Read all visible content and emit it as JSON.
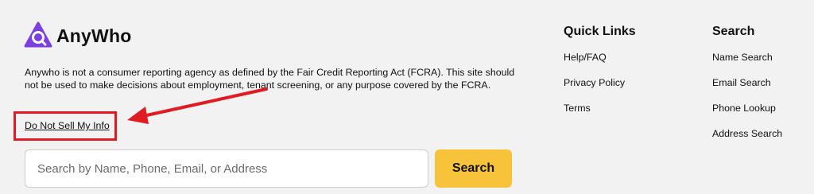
{
  "brand": {
    "name": "AnyWho",
    "accent_color": "#7b3fe4"
  },
  "disclaimer": {
    "text": "Anywho is not a consumer reporting agency as defined by the Fair Credit Reporting Act (FCRA). This site should not be used to make decisions about employment, tenant screening, or any purpose covered by the FCRA."
  },
  "do_not_sell": {
    "label": "Do Not Sell My Info"
  },
  "annotation": {
    "highlight_color": "#e11b22"
  },
  "search": {
    "placeholder": "Search by Name, Phone, Email, or Address",
    "value": "",
    "button_label": "Search",
    "button_color": "#f7c33b"
  },
  "quick_links": {
    "heading": "Quick Links",
    "items": [
      {
        "label": "Help/FAQ"
      },
      {
        "label": "Privacy Policy"
      },
      {
        "label": "Terms"
      }
    ]
  },
  "search_links": {
    "heading": "Search",
    "items": [
      {
        "label": "Name Search"
      },
      {
        "label": "Email Search"
      },
      {
        "label": "Phone Lookup"
      },
      {
        "label": "Address Search"
      }
    ]
  }
}
